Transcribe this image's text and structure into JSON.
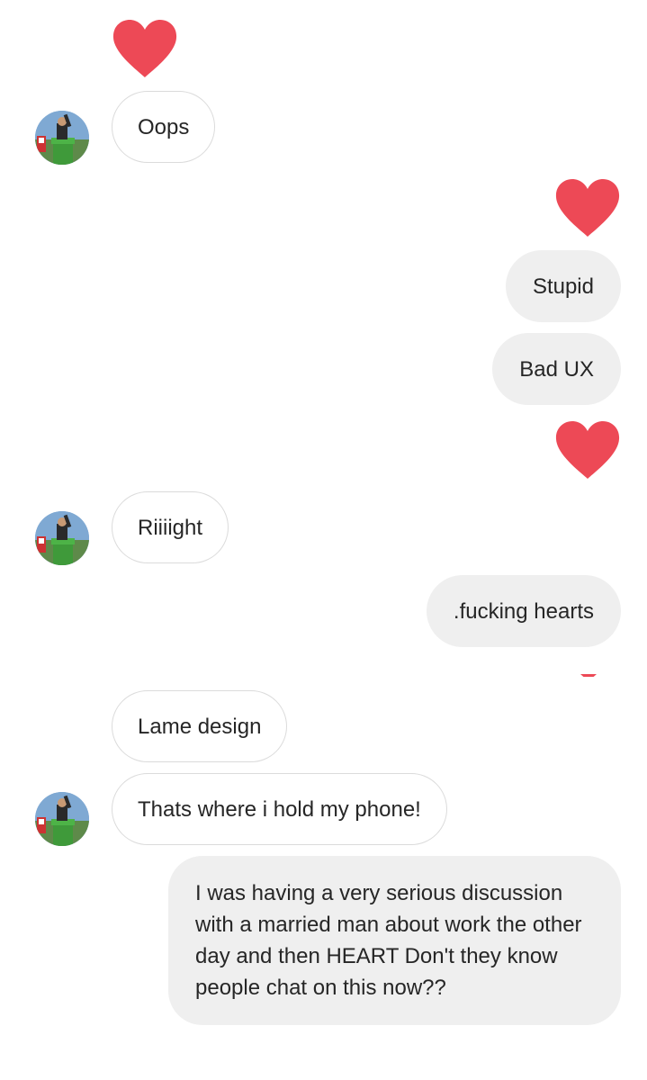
{
  "colors": {
    "heart": "#ed4956",
    "incoming_bubble_border": "#dbdbdb",
    "outgoing_bubble_bg": "#efefef",
    "text": "#262626"
  },
  "icons": {
    "reaction": "heart-icon",
    "avatar": "avatar"
  },
  "messages": {
    "m1": {
      "text": "Oops",
      "sender": "other"
    },
    "m2": {
      "text": "Stupid",
      "sender": "me"
    },
    "m3": {
      "text": "Bad UX",
      "sender": "me"
    },
    "m4": {
      "text": "Riiiight",
      "sender": "other"
    },
    "m5": {
      "text": ".fucking hearts",
      "sender": "me"
    },
    "m6": {
      "text": "Lame design",
      "sender": "other"
    },
    "m7": {
      "text": "Thats where i hold my phone!",
      "sender": "other"
    },
    "m8": {
      "text": "I was having a very serious discussion with a married man about work the other day and then HEART Don't they know people chat on this now??",
      "sender": "me"
    }
  }
}
